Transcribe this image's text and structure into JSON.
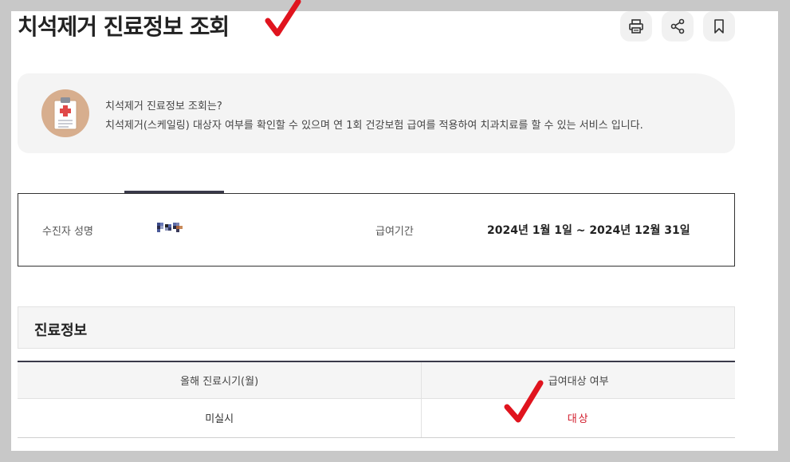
{
  "header": {
    "title": "치석제거 진료정보 조회",
    "icons": [
      "print-icon",
      "share-icon",
      "bookmark-icon"
    ]
  },
  "info": {
    "question": "치석제거 진료정보 조회는?",
    "description": "치석제거(스케일링) 대상자 여부를 확인할 수 있으며 연 1회 건강보험 급여를 적용하여 치과치료를 할 수 있는 서비스 입니다."
  },
  "recipient": {
    "name_label": "수진자 성명",
    "period_label": "급여기간",
    "period_value": "2024년 1월 1일 ~ 2024년 12월 31일"
  },
  "medical_info": {
    "section_title": "진료정보",
    "columns": [
      "올해 진료시기(월)",
      "급여대상 여부"
    ],
    "rows": [
      [
        "미실시",
        "대상"
      ]
    ]
  },
  "colors": {
    "accent_dark": "#3a3a4a",
    "highlight_red": "#d11a2a",
    "annotation_red": "#e0141e"
  }
}
